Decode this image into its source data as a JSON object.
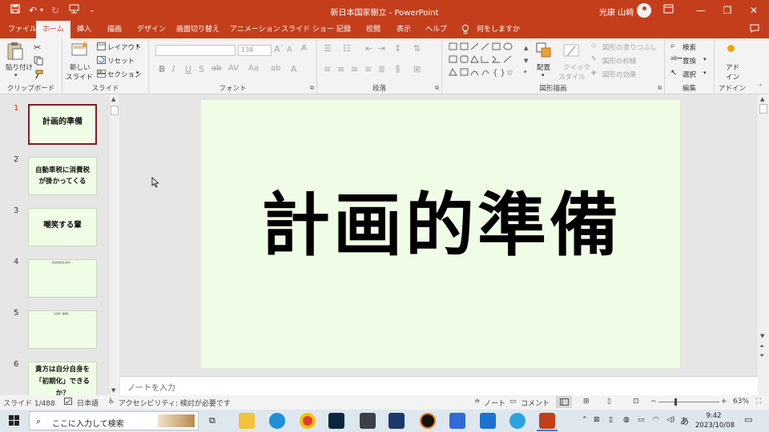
{
  "titlebar": {
    "title": "新日本国家樹立 - PowerPoint",
    "user": "光康 山崎",
    "save_icon": "save-icon",
    "undo_icon": "undo-icon",
    "redo_icon": "redo-icon",
    "minimize": "—",
    "restore": "❐",
    "close": "✕"
  },
  "tabs": [
    "ファイル",
    "ホーム",
    "挿入",
    "描画",
    "デザイン",
    "画面切り替え",
    "アニメーション",
    "スライド ショー",
    "記録",
    "校閲",
    "表示",
    "ヘルプ",
    "何をしますか"
  ],
  "ribbon": {
    "clipboard": {
      "paste": "貼り付け",
      "label": "クリップボード"
    },
    "slides": {
      "new_slide": "新しい",
      "new_slide2": "スライド",
      "layout": "レイアウト",
      "reset": "リセット",
      "section": "セクション",
      "label": "スライド"
    },
    "font": {
      "size": "138",
      "label": "フォント"
    },
    "paragraph": {
      "label": "段落"
    },
    "drawing": {
      "arrange": "配置",
      "quick_style": "クイック",
      "quick_style2": "スタイル",
      "fill": "図形の塗りつぶし",
      "outline": "図形の枠線",
      "effects": "図形の効果",
      "label": "図形描画"
    },
    "editing": {
      "find": "検索",
      "replace": "置換",
      "select": "選択",
      "label": "編集"
    },
    "addins": {
      "addin": "アド",
      "addin2": "イン",
      "label": "アドイン"
    }
  },
  "thumbnails": [
    {
      "num": "1",
      "title": "計画的準備"
    },
    {
      "num": "2",
      "title": "自動車税に消費税が掛かってくる"
    },
    {
      "num": "3",
      "title": "嘲笑する輩"
    },
    {
      "num": "4",
      "title": "",
      "text": "内政会報直接の勧力 ..."
    },
    {
      "num": "5",
      "title": "",
      "text": "自治体・保険料 ..."
    },
    {
      "num": "6",
      "title": "貴方は自分自身を「初期化」できるか？"
    }
  ],
  "slide": {
    "title": "計画的準備",
    "background": "#f0fde6"
  },
  "notes": {
    "placeholder": "ノートを入力"
  },
  "status": {
    "slide_index": "スライド 1/488",
    "language": "日本語",
    "accessibility": "アクセシビリティ: 検討が必要です",
    "notes": "ノート",
    "comments": "コメント",
    "zoom": "63%"
  },
  "taskbar": {
    "search_placeholder": "ここに入力して検索",
    "time": "9:42",
    "date": "2023/10/08",
    "ime": "あ"
  },
  "colors": {
    "accent": "#c43e1c",
    "slide_bg": "#f0fde6"
  }
}
